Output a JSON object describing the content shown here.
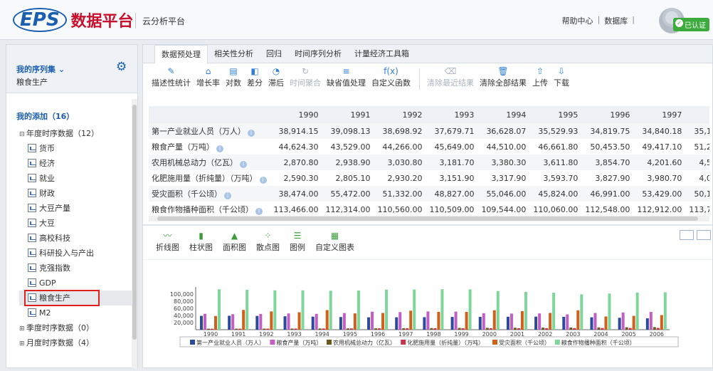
{
  "header": {
    "logo_text": "EPS",
    "brand_cn": "数据平台",
    "platform": "云分析平台",
    "links": [
      "帮助中心",
      "数据库"
    ],
    "badge": "已认证"
  },
  "sidebar": {
    "series_title": "我的序列集",
    "series_sub": "粮食生产",
    "my_add": "我的添加（16）",
    "group_annual": "年度时序数据（12）",
    "items": [
      "货币",
      "经济",
      "就业",
      "财政",
      "大豆产量",
      "大豆",
      "高校科技",
      "科研投入与产出",
      "克强指数",
      "GDP",
      "粮食生产",
      "M2"
    ],
    "selected": "粮食生产",
    "group_quarter": "季度时序数据（0）",
    "group_month": "月度时序数据（4）"
  },
  "tabs": [
    "数据预处理",
    "相关性分析",
    "回归",
    "时间序列分析",
    "计量经济工具箱"
  ],
  "toolbar": [
    {
      "icon": "edit-icon",
      "glyph": "✎",
      "label": "描述性统计",
      "disabled": false
    },
    {
      "icon": "growth-icon",
      "glyph": "⌂",
      "label": "增长率",
      "disabled": false
    },
    {
      "icon": "log-icon",
      "glyph": "▤",
      "label": "对数",
      "disabled": false
    },
    {
      "icon": "diff-icon",
      "glyph": "◧",
      "label": "差分",
      "disabled": false
    },
    {
      "icon": "lag-icon",
      "glyph": "◔",
      "label": "滞后",
      "disabled": false
    },
    {
      "icon": "aggregate-icon",
      "glyph": "↻",
      "label": "时间聚合",
      "disabled": true
    },
    {
      "icon": "missing-icon",
      "glyph": "≡",
      "label": "缺省值处理",
      "disabled": false
    },
    {
      "icon": "function-icon",
      "glyph": "f(x)",
      "label": "自定义函数",
      "disabled": false
    },
    {
      "sep": true
    },
    {
      "icon": "eraser-icon",
      "glyph": "⌫",
      "label": "清除最近结果",
      "disabled": true
    },
    {
      "icon": "trash-icon",
      "glyph": "🗑",
      "label": "清除全部结果",
      "disabled": false
    },
    {
      "icon": "upload-icon",
      "glyph": "⇧",
      "label": "上传",
      "disabled": false
    },
    {
      "icon": "download-icon",
      "glyph": "⇩",
      "label": "下载",
      "disabled": false
    }
  ],
  "table": {
    "years": [
      "1990",
      "1991",
      "1992",
      "1993",
      "1994",
      "1995",
      "1996",
      "1997",
      "1998"
    ],
    "rows": [
      {
        "name": "第一产业就业人员（万人）",
        "values": [
          "38,914.15",
          "39,098.13",
          "38,698.92",
          "37,679.71",
          "36,628.07",
          "35,529.93",
          "34,819.75",
          "34,840.18",
          "35,177.23"
        ]
      },
      {
        "name": "粮食产量（万吨）",
        "values": [
          "44,624.30",
          "43,529.00",
          "44,266.00",
          "45,649.00",
          "44,510.00",
          "46,661.80",
          "50,453.50",
          "49,417.10",
          "51,230.00"
        ]
      },
      {
        "name": "农用机械总动力（亿瓦）",
        "values": [
          "2,870.80",
          "2,938.90",
          "3,030.80",
          "3,181.70",
          "3,380.30",
          "3,611.80",
          "3,854.70",
          "4,201.60",
          "4,520.80"
        ]
      },
      {
        "name": "化肥施用量（折纯量）（万吨）",
        "values": [
          "2,590.30",
          "2,805.10",
          "2,930.20",
          "3,151.90",
          "3,317.90",
          "3,593.70",
          "3,827.90",
          "3,980.70",
          "4,083.70"
        ]
      },
      {
        "name": "受灾面积（千公顷）",
        "values": [
          "38,474.00",
          "55,472.00",
          "51,332.00",
          "48,827.00",
          "55,046.00",
          "45,824.00",
          "46,991.00",
          "53,429.00",
          "50,145.00"
        ]
      },
      {
        "name": "粮食作物播种面积（千公顷）",
        "values": [
          "113,466.00",
          "112,314.00",
          "110,560.00",
          "110,509.00",
          "109,544.00",
          "110,060.00",
          "112,548.00",
          "112,912.00",
          "113,787.00"
        ]
      }
    ]
  },
  "chart_tools": [
    {
      "icon": "line-chart-icon",
      "glyph": "〰",
      "label": "折线图"
    },
    {
      "icon": "bar-chart-icon",
      "glyph": "▮",
      "label": "柱状图"
    },
    {
      "icon": "area-chart-icon",
      "glyph": "▲",
      "label": "面积图"
    },
    {
      "icon": "scatter-chart-icon",
      "glyph": "⁘",
      "label": "散点图"
    },
    {
      "icon": "legend-icon",
      "glyph": "☰",
      "label": "图例"
    },
    {
      "icon": "custom-chart-icon",
      "glyph": "▦",
      "label": "自定义图表"
    }
  ],
  "chart_data": {
    "type": "bar",
    "categories": [
      "1990",
      "1991",
      "1992",
      "1993",
      "1994",
      "1995",
      "1996",
      "1997",
      "1998",
      "1999",
      "2000",
      "2001",
      "2002",
      "2003",
      "2004",
      "2005",
      "2006"
    ],
    "yticks": [
      "100,000",
      "80,000",
      "60,000",
      "40,000",
      "20,000"
    ],
    "ylim": [
      0,
      120000
    ],
    "series": [
      {
        "name": "第一产业就业人员（万人）",
        "color": "#2b4a9b",
        "values": [
          38914,
          39098,
          38699,
          37680,
          36628,
          35530,
          34820,
          34840,
          35177,
          35768,
          36043,
          36399,
          36640,
          36204,
          34830,
          33442,
          31941
        ]
      },
      {
        "name": "粮食产量（万吨）",
        "color": "#c35fc4",
        "values": [
          44624,
          43529,
          44266,
          45649,
          44510,
          46662,
          50454,
          49417,
          51230,
          50839,
          46218,
          45264,
          45706,
          43070,
          46947,
          48402,
          49804
        ]
      },
      {
        "name": "农用机械总动力（亿瓦）",
        "color": "#6b5a1e",
        "values": [
          2871,
          2939,
          3031,
          3182,
          3380,
          3612,
          3855,
          4202,
          4521,
          4900,
          5257,
          5517,
          5793,
          6039,
          6403,
          6840,
          7252
        ]
      },
      {
        "name": "化肥施用量（折纯量）（万吨）",
        "color": "#c8324a",
        "values": [
          2590,
          2805,
          2930,
          3152,
          3318,
          3594,
          3828,
          3981,
          4084,
          4124,
          4146,
          4254,
          4339,
          4412,
          4637,
          4766,
          4928
        ]
      },
      {
        "name": "受灾面积（千公顷）",
        "color": "#d0601a",
        "values": [
          38474,
          55472,
          51332,
          48827,
          55046,
          45824,
          46991,
          53429,
          50145,
          49980,
          54688,
          52215,
          47119,
          54506,
          37106,
          38818,
          41091
        ]
      },
      {
        "name": "粮食作物播种面积（千公顷）",
        "color": "#7fd69a",
        "values": [
          113466,
          112314,
          110560,
          110509,
          109544,
          110060,
          112548,
          112912,
          113787,
          113161,
          108463,
          106080,
          103891,
          99410,
          101606,
          104278,
          104958
        ]
      }
    ]
  }
}
